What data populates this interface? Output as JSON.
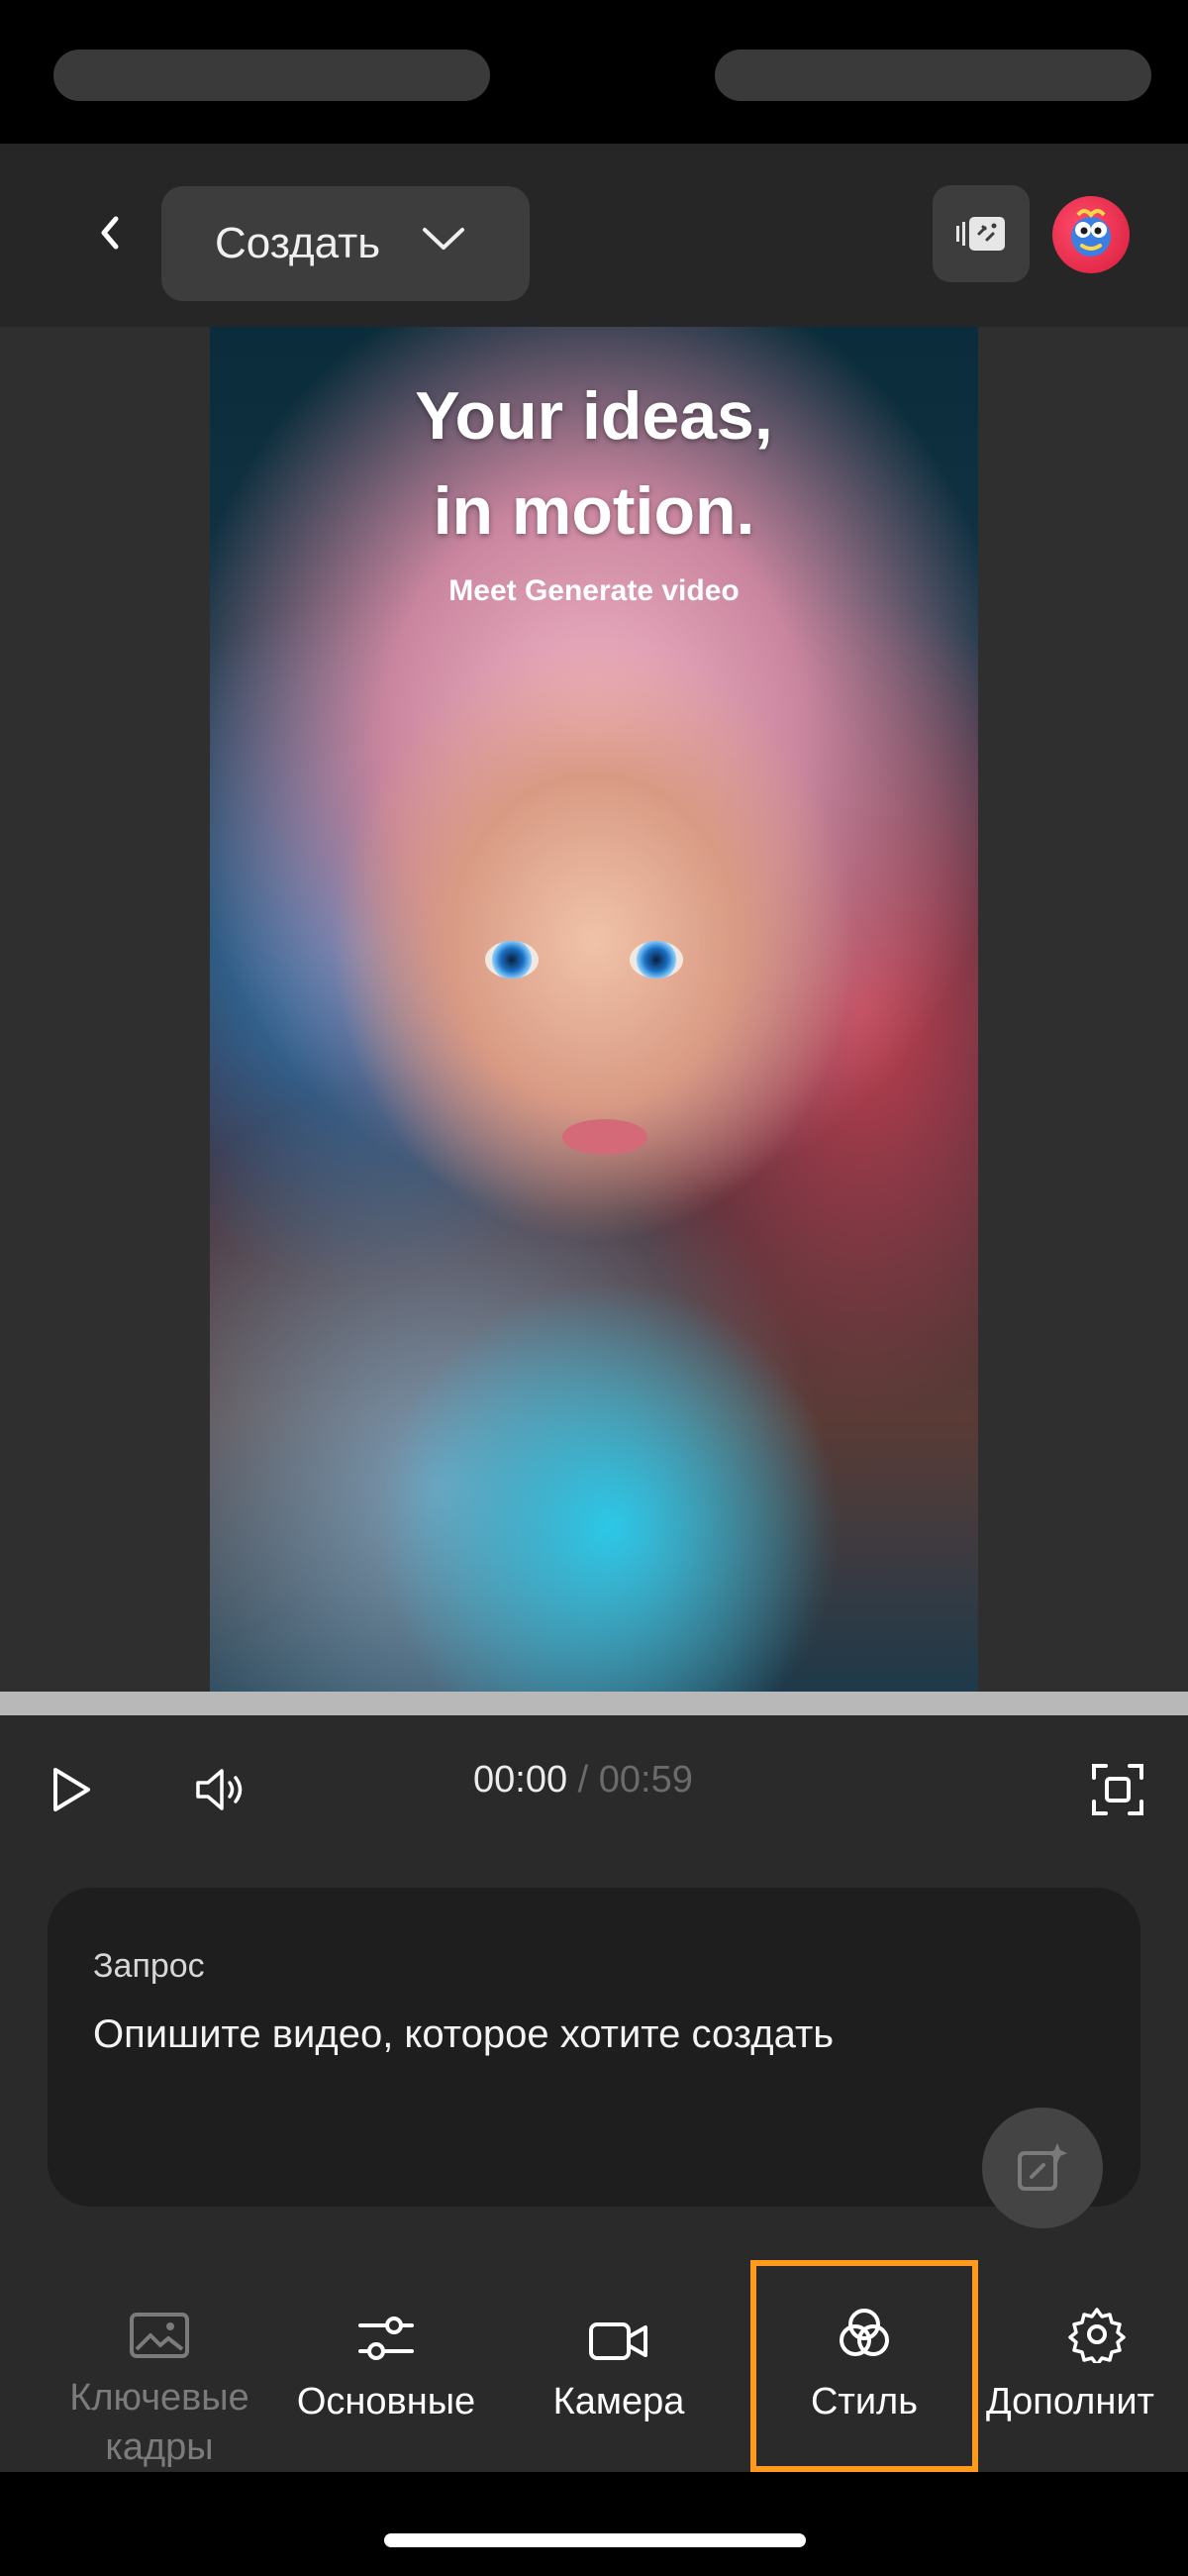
{
  "header": {
    "create_label": "Создать",
    "back_icon": "chevron-left-icon",
    "dropdown_icon": "chevron-down-icon",
    "gallery_icon": "media-stack-icon",
    "avatar_icon": "profile-avatar"
  },
  "preview": {
    "headline_line1": "Your ideas,",
    "headline_line2": "in motion.",
    "subtitle": "Meet Generate video"
  },
  "player": {
    "current_time": "00:00",
    "separator": "/",
    "duration": "00:59",
    "progress": 0
  },
  "prompt": {
    "label": "Запрос",
    "placeholder": "Опишите видео, которое хотите создать"
  },
  "toolbar": {
    "items": [
      {
        "line1": "Ключевые",
        "line2": "кадры",
        "icon": "image-icon",
        "enabled": false
      },
      {
        "label": "Основные",
        "icon": "sliders-icon"
      },
      {
        "label": "Камера",
        "icon": "video-camera-icon"
      },
      {
        "label": "Стиль",
        "icon": "style-circles-icon",
        "selected": true
      },
      {
        "label": "Дополнит",
        "icon": "gear-icon"
      }
    ]
  },
  "colors": {
    "selection_outline": "#ff9a1f",
    "background": "#2a2a2a",
    "card": "#1e1e1e"
  }
}
